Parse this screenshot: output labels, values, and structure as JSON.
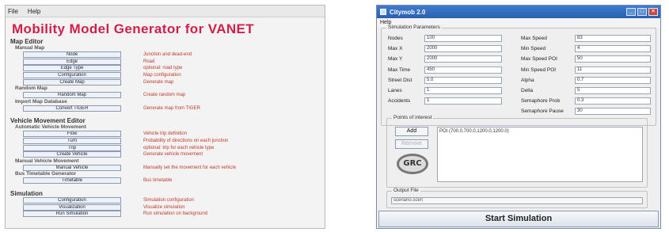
{
  "left_window": {
    "menu": [
      "File",
      "Help"
    ],
    "title": "Mobility Model Generator for VANET",
    "sections": [
      {
        "label": "Map Editor",
        "groups": [
          {
            "label": "Manual Map",
            "rows": [
              {
                "button": "Node",
                "desc": "Junction and dead-end"
              },
              {
                "button": "Edge",
                "desc": "Road"
              },
              {
                "button": "Edge Type",
                "desc": "optional: road type"
              },
              {
                "button": "Configuration",
                "desc": "Map configuration"
              },
              {
                "button": "Create Map",
                "desc": "Generate map"
              }
            ]
          },
          {
            "label": "Random Map",
            "rows": [
              {
                "button": "Random Map",
                "desc": "Create random map"
              }
            ]
          },
          {
            "label": "Import Map Database",
            "rows": [
              {
                "button": "Convert TIGER",
                "desc": "Generate map from TIGER"
              }
            ]
          }
        ]
      },
      {
        "label": "Vehicle Movement Editor",
        "groups": [
          {
            "label": "Automatic Vehicle Movement",
            "rows": [
              {
                "button": "Flow",
                "desc": "Vehicle trip definition"
              },
              {
                "button": "Turn",
                "desc": "Probability of directions on each junction"
              },
              {
                "button": "Trip",
                "desc": "optional: trip for each vehicle type"
              },
              {
                "button": "Create Vehicle",
                "desc": "Generate vehicle movement"
              }
            ]
          },
          {
            "label": "Manual Vehicle Movement",
            "rows": [
              {
                "button": "Manual Vehicle",
                "desc": "Manually set the movement for each vehicle"
              }
            ]
          },
          {
            "label": "Bus Timetable Generator",
            "rows": [
              {
                "button": "Timetable",
                "desc": "Bus timetable"
              }
            ]
          }
        ]
      },
      {
        "label": "Simulation",
        "groups": [
          {
            "label": "",
            "rows": [
              {
                "button": "Configuration",
                "desc": "Simulation configuration"
              },
              {
                "button": "Visualization",
                "desc": "Visualize simulation"
              },
              {
                "button": "Run Simulation",
                "desc": "Run simulation on background"
              }
            ]
          }
        ]
      }
    ]
  },
  "right_window": {
    "title": "Citymob 2.0",
    "menu": [
      "Help"
    ],
    "params_legend": "Simulation Parameters",
    "params_left": [
      {
        "label": "Nodes",
        "value": "100"
      },
      {
        "label": "Max X",
        "value": "2000"
      },
      {
        "label": "Max Y",
        "value": "2000"
      },
      {
        "label": "Max Time",
        "value": "450"
      },
      {
        "label": "Street Dist",
        "value": "5.0"
      },
      {
        "label": "Lanes",
        "value": "1"
      },
      {
        "label": "Accidents",
        "value": "1"
      }
    ],
    "params_right": [
      {
        "label": "Max Speed",
        "value": "83"
      },
      {
        "label": "Min Speed",
        "value": "4"
      },
      {
        "label": "Max Speed POI",
        "value": "50"
      },
      {
        "label": "Min Speed POI",
        "value": "11"
      },
      {
        "label": "Alpha",
        "value": "0.7"
      },
      {
        "label": "Delta",
        "value": "5"
      },
      {
        "label": "Semaphore Prob",
        "value": "0.3"
      },
      {
        "label": "Semaphore Pause",
        "value": "30"
      }
    ],
    "poi_legend": "Points of interest",
    "add_label": "Add",
    "remove_label": "Remove",
    "poi_text": "POI (700.0,700.0,1200.0,1200.0)",
    "logo_text": "GRC",
    "output_legend": "Output File",
    "output_value": "scenario.scen",
    "start_label": "Start Simulation"
  }
}
